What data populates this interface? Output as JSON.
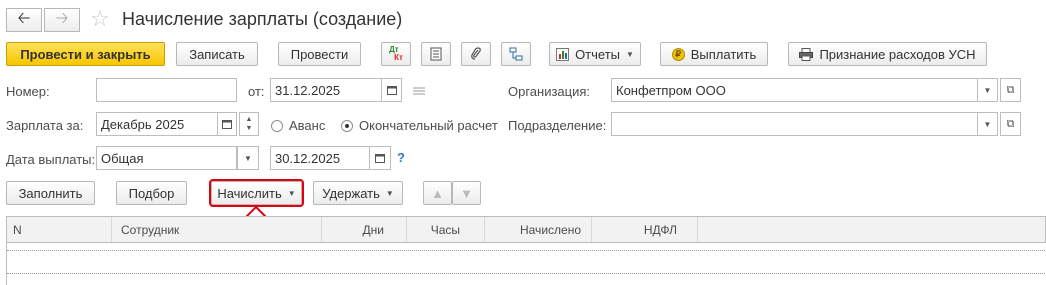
{
  "title": "Начисление зарплаты (создание)",
  "toolbar": {
    "post_close": "Провести и закрыть",
    "save": "Записать",
    "post": "Провести",
    "dtkt_top": "Дт",
    "dtkt_bottom": "Кт",
    "reports": "Отчеты",
    "pay": "Выплатить",
    "usn": "Признание расходов УСН"
  },
  "form": {
    "number_label": "Номер:",
    "number_value": "",
    "from_label": "от:",
    "date_value": "31.12.2025",
    "org_label": "Организация:",
    "org_value": "Конфетпром ООО",
    "salary_label": "Зарплата за:",
    "salary_value": "Декабрь 2025",
    "advance_label": "Аванс",
    "final_label": "Окончательный расчет",
    "dept_label": "Подразделение:",
    "dept_value": "",
    "paydate_label": "Дата выплаты:",
    "paydate_type": "Общая",
    "paydate_value": "30.12.2025",
    "help": "?"
  },
  "actions": {
    "fill": "Заполнить",
    "select": "Подбор",
    "accrue": "Начислить",
    "withhold": "Удержать"
  },
  "table": {
    "columns": [
      "N",
      "Сотрудник",
      "Дни",
      "Часы",
      "Начислено",
      "НДФЛ"
    ]
  },
  "colors": {
    "primary": "#f7c600",
    "highlight": "#e1000f"
  }
}
